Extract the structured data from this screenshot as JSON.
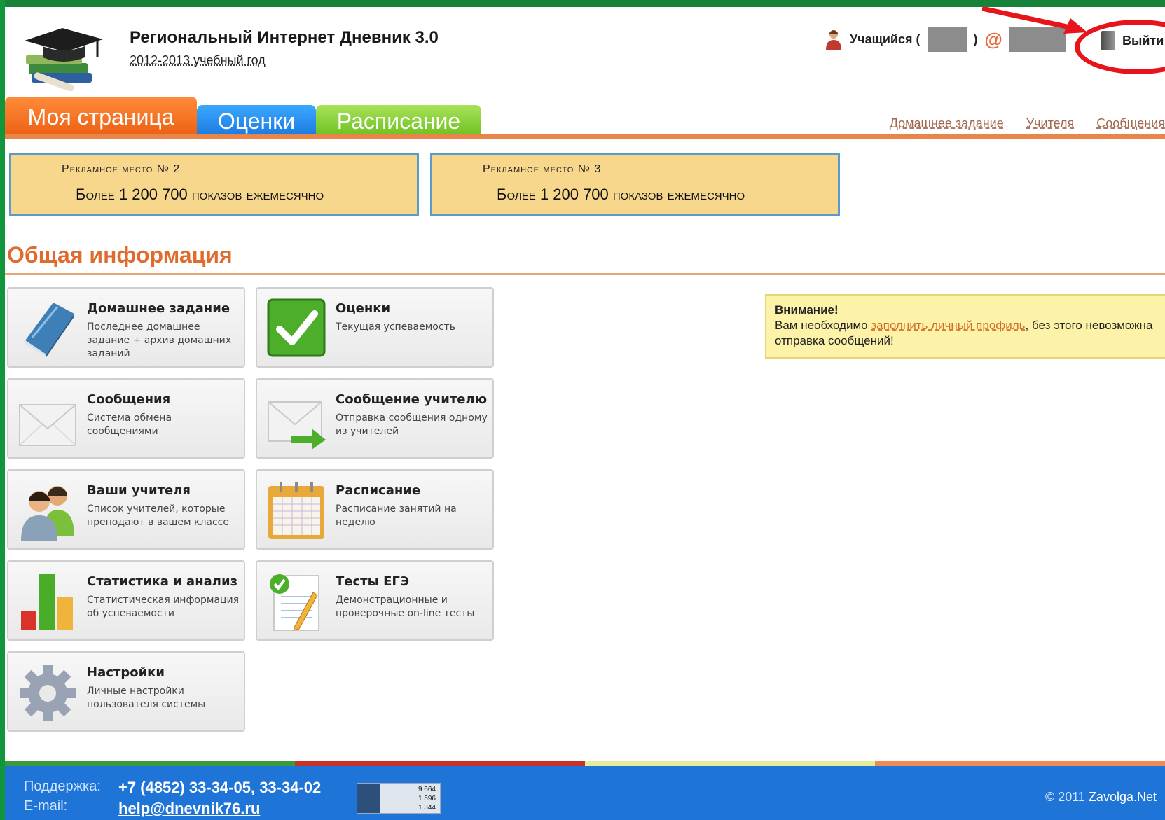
{
  "header": {
    "title": "Региональный Интернет Дневник 3.0",
    "year": "2012-2013 учебный год",
    "user_label": "Учащийся (",
    "user_close": ")",
    "logout_label": "Выйти"
  },
  "tabs": {
    "my_page": "Моя страница",
    "grades": "Оценки",
    "schedule": "Расписание"
  },
  "top_links": [
    "Домашнее задание",
    "Учителя",
    "Сообщения"
  ],
  "ads": [
    {
      "title": "Рекламное место № 2",
      "text": "Более 1 200 700 показов ежемесячно"
    },
    {
      "title": "Рекламное место № 3",
      "text": "Более 1 200 700 показов ежемесячно"
    }
  ],
  "section_title": "Общая информация",
  "tiles": [
    {
      "title": "Домашнее задание",
      "desc": "Последнее домашнее задание + архив домашних заданий",
      "icon": "book-icon"
    },
    {
      "title": "Оценки",
      "desc": "Текущая успеваемость",
      "icon": "checkmark-icon"
    },
    {
      "title": "Сообщения",
      "desc": "Система обмена сообщениями",
      "icon": "envelope-icon"
    },
    {
      "title": "Сообщение учителю",
      "desc": "Отправка сообщения одному из учителей",
      "icon": "send-message-icon"
    },
    {
      "title": "Ваши учителя",
      "desc": "Список учителей, которые преподают в вашем классе",
      "icon": "people-icon"
    },
    {
      "title": "Расписание",
      "desc": "Расписание занятий на неделю",
      "icon": "calendar-icon"
    },
    {
      "title": "Статистика и анализ",
      "desc": "Статистическая информация об успеваемости",
      "icon": "bar-chart-icon"
    },
    {
      "title": "Тесты ЕГЭ",
      "desc": "Демонстрационные и проверочные on-line тесты",
      "icon": "test-sheet-icon"
    },
    {
      "title": "Настройки",
      "desc": "Личные настройки пользователя системы",
      "icon": "gear-icon"
    }
  ],
  "notice": {
    "title": "Внимание!",
    "before": "Вам необходимо ",
    "link": "заполнить личный профиль",
    "after": ", без этого невозможна отправка сообщений!"
  },
  "footer": {
    "support_label": "Поддержка:",
    "email_label": "E-mail:",
    "phones": "+7 (4852) 33-34-05, 33-34-02",
    "email": "help@dnevnik76.ru",
    "counter": [
      "9 664",
      "1 596",
      "1 344"
    ],
    "copyright": "© 2011 ",
    "copyright_link": "Zavolga.Net"
  },
  "colors": {
    "orange_tab": "#ec5e12",
    "blue_tab": "#1b78e0",
    "green_tab": "#6bbf1d",
    "section_title": "#df6b2e",
    "footer": "#1f74d8",
    "annotation_red": "#e8141c"
  }
}
